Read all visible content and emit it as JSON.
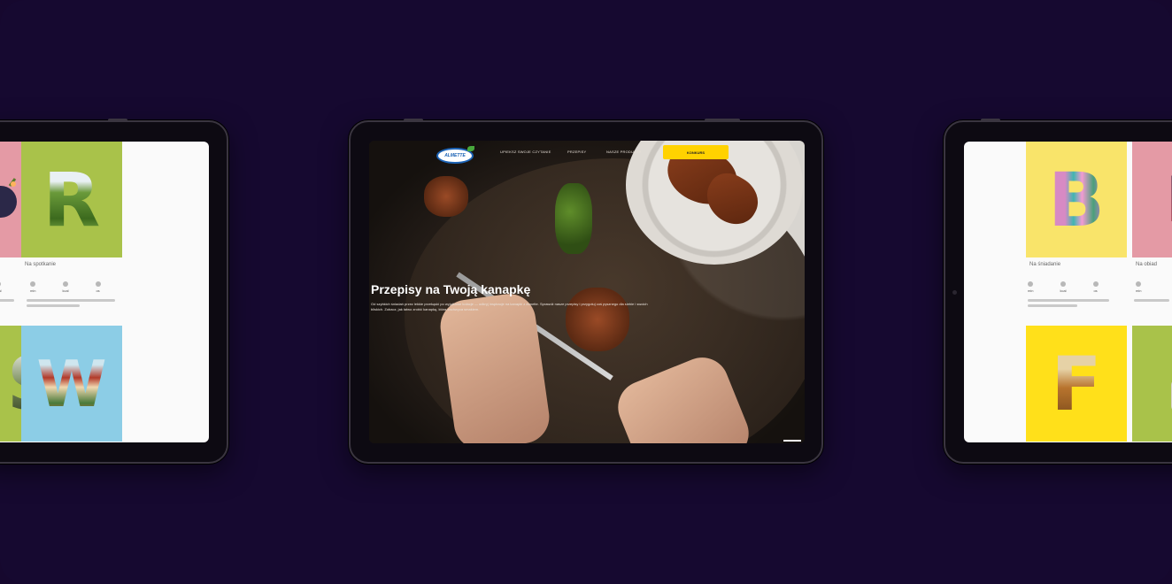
{
  "center": {
    "logo_text": "ALMETTE",
    "nav": [
      "UPIEKSZ SWOJE CZYTANIE",
      "PRZEPISY",
      "NASZE PRODUKTY"
    ],
    "cta_label": "KONKURS",
    "hero_title": "Przepisy na Twoją kanapkę",
    "hero_text": "Od szybkich śniadań przez lekkie przekąski po wyjątkowe kolacje — odkryj inspiracje na kanapki z Almette. Sprawdź nasze przepisy i przygotuj coś pysznego dla siebie i swoich bliskich. Zobacz, jak łatwo zrobić kanapkę, która zachwyca smakiem."
  },
  "left": {
    "cards": [
      {
        "letter": "R",
        "caption": "Na spotkanie"
      },
      {
        "letter": "W",
        "caption": ""
      }
    ],
    "mini_labels": [
      "min",
      "kcal",
      "os",
      "łatwe"
    ]
  },
  "right": {
    "cards": [
      {
        "letter": "B",
        "caption": "Na śniadanie"
      },
      {
        "letter": "F",
        "caption": ""
      },
      {
        "letter": "",
        "caption": "Na obiad"
      }
    ],
    "mini_labels": [
      "min",
      "kcal",
      "os",
      "łatwe"
    ]
  },
  "colors": {
    "background": "#160930",
    "cta": "#ffd200",
    "card_pink": "#e49aa5",
    "card_green": "#a9c24a",
    "card_blue": "#8ccde6",
    "card_yellow": "#f9e46a"
  }
}
